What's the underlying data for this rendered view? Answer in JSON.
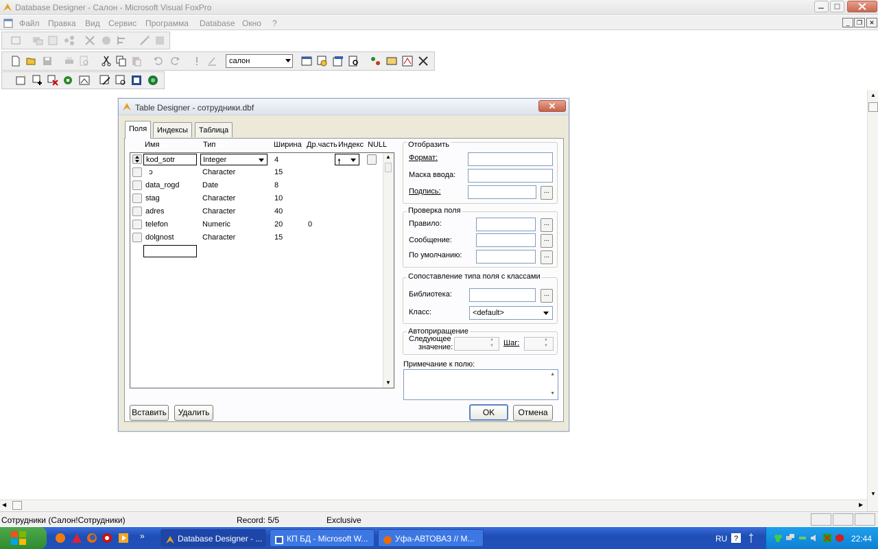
{
  "window": {
    "title": "Database Designer - Салон - Microsoft Visual FoxPro"
  },
  "menu": [
    "Файл",
    "Правка",
    "Вид",
    "Сервис",
    "Программа",
    "Database",
    "Окно",
    "?"
  ],
  "toolbar": {
    "database_combo": "салон"
  },
  "dialog": {
    "title": "Table Designer - сотрудники.dbf",
    "tabs": [
      "Поля",
      "Индексы",
      "Таблица"
    ],
    "columns": {
      "name": "Имя",
      "type": "Тип",
      "width": "Ширина",
      "decimal": "Др.часть",
      "index": "Индекс",
      "null": "NULL"
    },
    "fields": [
      {
        "name": "kod_sotr",
        "type": "Integer",
        "width": "4",
        "decimal": ""
      },
      {
        "name": "ɔ",
        "type": "Character",
        "width": "15",
        "decimal": ""
      },
      {
        "name": "data_rogd",
        "type": "Date",
        "width": "8",
        "decimal": ""
      },
      {
        "name": "stag",
        "type": "Character",
        "width": "10",
        "decimal": ""
      },
      {
        "name": "adres",
        "type": "Character",
        "width": "40",
        "decimal": ""
      },
      {
        "name": "telefon",
        "type": "Numeric",
        "width": "20",
        "decimal": "0"
      },
      {
        "name": "dolgnost",
        "type": "Character",
        "width": "15",
        "decimal": ""
      }
    ],
    "display": {
      "legend": "Отобразить",
      "format": "Формат:",
      "input_mask": "Маска ввода:",
      "caption": "Подпись:"
    },
    "validation": {
      "legend": "Проверка поля",
      "rule": "Правило:",
      "message": "Сообщение:",
      "default": "По умолчанию:"
    },
    "mapping": {
      "legend": "Сопоставление типа поля с классами",
      "library": "Библиотека:",
      "class": "Класс:",
      "class_value": "<default>"
    },
    "autoinc": {
      "legend": "Автоприращение",
      "next_1": "Следующее",
      "next_2": "значение:",
      "step": "Шаг:"
    },
    "comment_label": "Примечание к полю:",
    "buttons": {
      "insert": "Вставить",
      "delete": "Удалить",
      "ok": "OK",
      "cancel": "Отмена"
    }
  },
  "status": {
    "table": "Сотрудники (Салон!Сотрудники)",
    "record": "Record: 5/5",
    "mode": "Exclusive"
  },
  "taskbar": {
    "tasks": [
      "Database Designer - ...",
      "КП БД - Microsoft W...",
      "Уфа-АВТОВАЗ // М..."
    ],
    "lang": "RU",
    "clock": "22:44"
  }
}
